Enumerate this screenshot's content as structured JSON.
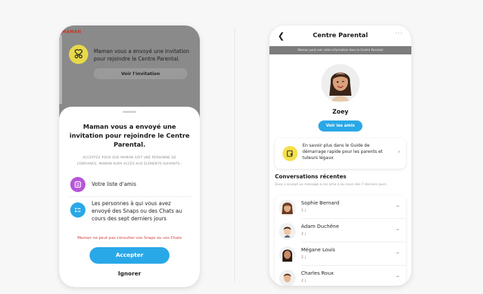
{
  "left": {
    "bg_label": "MAMAN",
    "bg_text": "Maman vous a envoyé une invitation pour rejoindre le Centre Parental.",
    "bg_button": "Voir l'invitation",
    "sheet_title": "Maman vous a envoyé une invitation pour rejoindre le Centre Parental.",
    "sheet_sub": "ACCEPTEZ POUR QUE MAMAN SOIT UNE PERSONNE DE CONFIANCE. MAMAN AURA ACCÈS AUX ÉLÉMENTS SUIVANTS :",
    "features": [
      {
        "label": "Votre liste d'amis",
        "icon": "friends-list-icon",
        "color": "#b655d8"
      },
      {
        "label": "Les personnes à qui vous avez envoyé des Snaps ou des Chats au cours des sept derniers jours",
        "icon": "chat-list-icon",
        "color": "#29a8e8"
      }
    ],
    "warning": "Maman ne peut pas consulter vos Snaps ou vos Chats",
    "accept": "Accepter",
    "ignore": "Ignorer"
  },
  "right": {
    "title": "Centre Parental",
    "more": "···",
    "banner": "Maman peut voir cette information dans le Centre Parental",
    "name": "Zoey",
    "friends_button": "Voir les amis",
    "guide_text": "En savoir plus dans le Guide de démarrage rapide pour les parents et tuteurs légaux",
    "section_title": "Conversations récentes",
    "section_sub": "Zoey a envoyé un message à ces amis à au cours des 7 derniers jours",
    "conversations": [
      {
        "name": "Sophie Bernard",
        "time": "1 j",
        "action": "→"
      },
      {
        "name": "Adam Duchêne",
        "time": "2 j",
        "action": "→"
      },
      {
        "name": "Mégane Louis",
        "time": "2 j",
        "action": "→"
      },
      {
        "name": "Charles Roux",
        "time": "2 j",
        "action": "→"
      }
    ]
  },
  "colors": {
    "accent": "#29a8e8",
    "warning": "#d23b3b",
    "snap_yellow": "#f5e04a"
  }
}
